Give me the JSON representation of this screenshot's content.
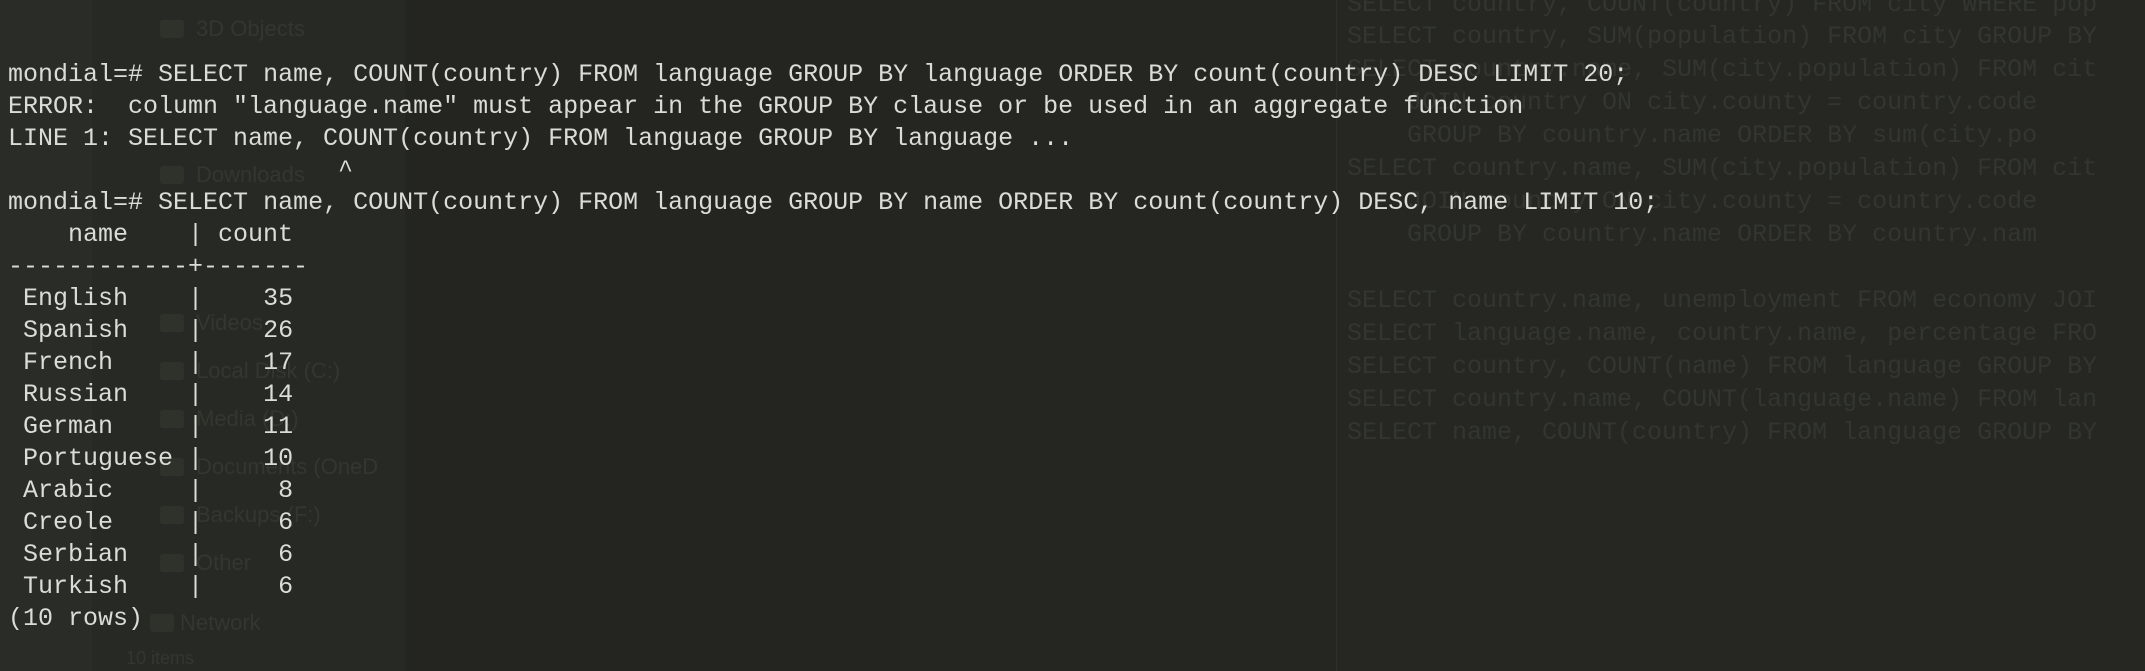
{
  "terminal": {
    "prompt": "mondial=#",
    "query1": "SELECT name, COUNT(country) FROM language GROUP BY language ORDER BY count(country) DESC LIMIT 20;",
    "error_line": "ERROR:  column \"language.name\" must appear in the GROUP BY clause or be used in an aggregate function",
    "error_context": "LINE 1: SELECT name, COUNT(country) FROM language GROUP BY language ...",
    "error_caret": "                      ^",
    "query2": "SELECT name, COUNT(country) FROM language GROUP BY name ORDER BY count(country) DESC, name LIMIT 10;",
    "result": {
      "header": "    name    | count",
      "separator": "------------+-------",
      "rows": [
        {
          "name": "English",
          "count": "35"
        },
        {
          "name": "Spanish",
          "count": "26"
        },
        {
          "name": "French",
          "count": "17"
        },
        {
          "name": "Russian",
          "count": "14"
        },
        {
          "name": "German",
          "count": "11"
        },
        {
          "name": "Portuguese",
          "count": "10"
        },
        {
          "name": "Arabic",
          "count": "8"
        },
        {
          "name": "Creole",
          "count": "6"
        },
        {
          "name": "Serbian",
          "count": "6"
        },
        {
          "name": "Turkish",
          "count": "6"
        }
      ],
      "footer": "(10 rows)"
    }
  },
  "background": {
    "explorer_items": [
      "3D Objects",
      "Downloads",
      "Videos",
      "Local Disk (C:)",
      "Media (D:)",
      "Documents (OneD",
      "Backups (F:)",
      "Other",
      "Network",
      "10 items"
    ],
    "editor_lines": [
      "SELECT country, COUNT(country) FROM city WHERE pop",
      "SELECT country, SUM(population) FROM city GROUP BY",
      "SELECT country.name, SUM(city.population) FROM cit",
      "    JOIN country ON city.county = country.code",
      "    GROUP BY country.name ORDER BY sum(city.po",
      "SELECT country.name, SUM(city.population) FROM cit",
      "    JOIN country ON city.county = country.code",
      "    GROUP BY country.name ORDER BY country.nam",
      "",
      "SELECT country.name, unemployment FROM economy JOI",
      "SELECT language.name, country.name, percentage FRO",
      "SELECT country, COUNT(name) FROM language GROUP BY",
      "SELECT country.name, COUNT(language.name) FROM lan",
      "SELECT name, COUNT(country) FROM language GROUP BY"
    ]
  }
}
